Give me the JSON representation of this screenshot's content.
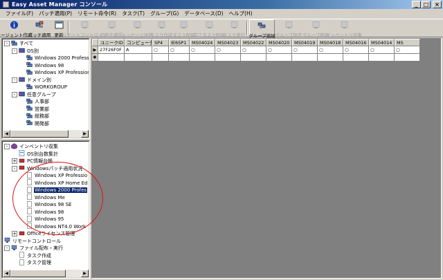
{
  "window": {
    "title": "Easy Asset Manager コンソール",
    "buttons": [
      "_",
      "□",
      "×"
    ]
  },
  "menu": [
    "ファイル(F)",
    "パッチ適用(P)",
    "リモート命令(R)",
    "タスク(T)",
    "グループ(G)",
    "データベース(D)",
    "ヘルプ(H)"
  ],
  "toolbar": [
    {
      "label": "エージェント作成",
      "icon": "info-icon",
      "enabled": true,
      "pressed": false
    },
    {
      "label": "パッチ適用",
      "icon": "patch-icon",
      "enabled": true,
      "pressed": false
    },
    {
      "label": "更新",
      "icon": "refresh-icon",
      "enabled": true,
      "pressed": false
    },
    {
      "label": "リモートコントロール",
      "icon": "remote-control-icon",
      "enabled": false,
      "pressed": false
    },
    {
      "label": "応答を確認",
      "icon": "check-response-icon",
      "enabled": false,
      "pressed": false
    },
    {
      "label": "メッセージ送信",
      "icon": "message-icon",
      "enabled": false,
      "pressed": false
    },
    {
      "label": "タスク作成",
      "icon": "task-create-icon",
      "enabled": false,
      "pressed": false
    },
    {
      "label": "タスク削除",
      "icon": "task-delete-icon",
      "enabled": false,
      "pressed": false
    },
    {
      "label": "完了タスク削除",
      "icon": "completed-task-delete-icon",
      "enabled": false,
      "pressed": false
    },
    {
      "label": "タスク実行",
      "icon": "task-run-icon",
      "enabled": false,
      "pressed": false
    },
    {
      "label": "グループ追加",
      "icon": "group-add-icon",
      "enabled": true,
      "pressed": true
    },
    {
      "label": "グループ設定",
      "icon": "group-settings-icon",
      "enabled": false,
      "pressed": false
    },
    {
      "label": "グループ削除",
      "icon": "group-delete-icon",
      "enabled": false,
      "pressed": false
    },
    {
      "label": "インベントリ収集",
      "icon": "inventory-collect-icon",
      "enabled": false,
      "pressed": false
    }
  ],
  "tree1": [
    {
      "label": "すべて",
      "level": 0,
      "toggle": "-",
      "icon": "computers-icon"
    },
    {
      "label": "OS別",
      "level": 1,
      "toggle": "-",
      "icon": "folder-icon"
    },
    {
      "label": "Windows 2000 Profession",
      "level": 2,
      "toggle": "",
      "icon": "computer-group-icon"
    },
    {
      "label": "Windows 98",
      "level": 2,
      "toggle": "",
      "icon": "computer-group-icon"
    },
    {
      "label": "Windows XP Professional",
      "level": 2,
      "toggle": "",
      "icon": "computer-group-icon"
    },
    {
      "label": "ドメイン別",
      "level": 1,
      "toggle": "-",
      "icon": "folder-icon"
    },
    {
      "label": "WORKGROUP",
      "level": 2,
      "toggle": "",
      "icon": "computer-group-icon"
    },
    {
      "label": "任意グループ",
      "level": 1,
      "toggle": "-",
      "icon": "folder-icon"
    },
    {
      "label": "人事部",
      "level": 2,
      "toggle": "",
      "icon": "computer-group-icon"
    },
    {
      "label": "営業部",
      "level": 2,
      "toggle": "",
      "icon": "computer-group-icon"
    },
    {
      "label": "総務部",
      "level": 2,
      "toggle": "",
      "icon": "computer-group-icon"
    },
    {
      "label": "開発部",
      "level": 2,
      "toggle": "",
      "icon": "computer-group-icon"
    }
  ],
  "tree2": [
    {
      "label": "インベントリ収集",
      "level": 0,
      "toggle": "-",
      "icon": "inventory-icon",
      "selected": false
    },
    {
      "label": "OS別台数集計",
      "level": 1,
      "toggle": "",
      "icon": "report-icon",
      "selected": false
    },
    {
      "label": "PC情報台帳",
      "level": 1,
      "toggle": "+",
      "icon": "ledger-icon",
      "selected": false
    },
    {
      "label": "Windowsパッチ適用状況",
      "level": 1,
      "toggle": "-",
      "icon": "patch-status-icon",
      "selected": false
    },
    {
      "label": "Windows XP Professio",
      "level": 2,
      "toggle": "",
      "icon": "document-icon",
      "selected": false
    },
    {
      "label": "Windows XP Home Ed",
      "level": 2,
      "toggle": "",
      "icon": "document-icon",
      "selected": false
    },
    {
      "label": "Windows 2000 Profes",
      "level": 2,
      "toggle": "",
      "icon": "document-icon",
      "selected": true
    },
    {
      "label": "Windows Me",
      "level": 2,
      "toggle": "",
      "icon": "document-icon",
      "selected": false
    },
    {
      "label": "Windows 98 SE",
      "level": 2,
      "toggle": "",
      "icon": "document-icon",
      "selected": false
    },
    {
      "label": "Windows 98",
      "level": 2,
      "toggle": "",
      "icon": "document-icon",
      "selected": false
    },
    {
      "label": "Windows 95",
      "level": 2,
      "toggle": "",
      "icon": "document-icon",
      "selected": false
    },
    {
      "label": "Windows NT4.0 Work",
      "level": 2,
      "toggle": "",
      "icon": "document-icon",
      "selected": false
    },
    {
      "label": "Officeライセンス管理",
      "level": 1,
      "toggle": "+",
      "icon": "license-icon",
      "selected": false
    },
    {
      "label": "リモートコントロール",
      "level": 0,
      "toggle": "",
      "icon": "remote-icon",
      "selected": false
    },
    {
      "label": "ファイル配布・実行",
      "level": 0,
      "toggle": "-",
      "icon": "distribute-icon",
      "selected": false
    },
    {
      "label": "タスク作成",
      "level": 1,
      "toggle": "",
      "icon": "document-icon",
      "selected": false
    },
    {
      "label": "タスク管理",
      "level": 1,
      "toggle": "",
      "icon": "document-icon",
      "selected": false
    }
  ],
  "grid": {
    "columns": [
      "ユニークID",
      "コンピュータ名",
      "SP4",
      "IE6SP1",
      "MS04024",
      "MS04023",
      "MS04022",
      "MS04020",
      "MS04019",
      "MS04018",
      "MS04016",
      "MS04014",
      "MS"
    ],
    "rows": [
      {
        "marker": "▶",
        "cells": [
          "27F26F0F",
          "A",
          "○",
          "○",
          "○",
          "○",
          "○",
          "○",
          "○",
          "○",
          "○",
          "○",
          "○"
        ]
      },
      {
        "marker": "✱",
        "cells": [
          "",
          "",
          "",
          "",
          "",
          "",
          "",
          "",
          "",
          "",
          "",
          "",
          ""
        ]
      }
    ]
  },
  "colors": {
    "titlebar": "#0a246a",
    "selection": "#0a246a",
    "annotation": "#e01010",
    "grid_background": "#808080"
  }
}
